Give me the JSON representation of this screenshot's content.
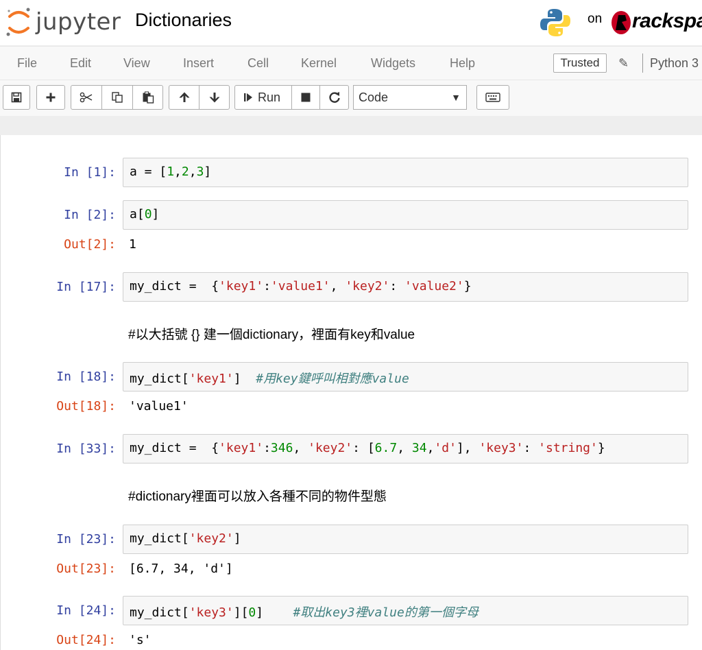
{
  "header": {
    "logo_text": "jupyter",
    "notebook_title": "Dictionaries",
    "on_text": "on",
    "rackspace_text": "rackspace"
  },
  "menubar": {
    "items": [
      "File",
      "Edit",
      "View",
      "Insert",
      "Cell",
      "Kernel",
      "Widgets",
      "Help"
    ],
    "trusted_label": "Trusted",
    "kernel_name": "Python 3"
  },
  "toolbar": {
    "run_label": "Run",
    "cell_type": "Code",
    "buttons": [
      "save-icon",
      "plus-icon",
      "scissors-icon",
      "copy-icon",
      "paste-icon",
      "arrow-up-icon",
      "arrow-down-icon",
      "run-icon",
      "stop-icon",
      "restart-icon",
      "keyboard-icon"
    ]
  },
  "colors": {
    "in_prompt": "#303f9f",
    "out_prompt": "#d84315",
    "number": "#008800",
    "string": "#ba2121",
    "comment": "#408080",
    "logo_orange": "#f37726"
  },
  "cells": [
    {
      "in_prompt": "In [1]:",
      "code": [
        [
          "a = [",
          ""
        ],
        [
          "1",
          "num"
        ],
        [
          ",",
          ""
        ],
        [
          "2",
          "num"
        ],
        [
          ",",
          ""
        ],
        [
          "3",
          "num"
        ],
        [
          "]",
          ""
        ]
      ]
    },
    {
      "in_prompt": "In [2]:",
      "code": [
        [
          "a[",
          ""
        ],
        [
          "0",
          "num"
        ],
        [
          "]",
          ""
        ]
      ],
      "out_prompt": "Out[2]:",
      "output": "1"
    },
    {
      "in_prompt": "In [17]:",
      "code": [
        [
          "my_dict =  {",
          ""
        ],
        [
          "'key1'",
          "str"
        ],
        [
          ":",
          ""
        ],
        [
          "'value1'",
          "str"
        ],
        [
          ", ",
          ""
        ],
        [
          "'key2'",
          "str"
        ],
        [
          ": ",
          ""
        ],
        [
          "'value2'",
          "str"
        ],
        [
          "}",
          ""
        ]
      ]
    },
    {
      "markdown": "#以大括號 {} 建一個dictionary，裡面有key和value"
    },
    {
      "in_prompt": "In [18]:",
      "code": [
        [
          "my_dict[",
          ""
        ],
        [
          "'key1'",
          "str"
        ],
        [
          "]  ",
          ""
        ],
        [
          "#用key鍵呼叫相對應value",
          "cm"
        ]
      ],
      "out_prompt": "Out[18]:",
      "output": "'value1'"
    },
    {
      "in_prompt": "In [33]:",
      "code": [
        [
          "my_dict =  {",
          ""
        ],
        [
          "'key1'",
          "str"
        ],
        [
          ":",
          ""
        ],
        [
          "346",
          "num"
        ],
        [
          ", ",
          ""
        ],
        [
          "'key2'",
          "str"
        ],
        [
          ": [",
          ""
        ],
        [
          "6.7",
          "num"
        ],
        [
          ", ",
          ""
        ],
        [
          "34",
          "num"
        ],
        [
          ",",
          ""
        ],
        [
          "'d'",
          "str"
        ],
        [
          "], ",
          ""
        ],
        [
          "'key3'",
          "str"
        ],
        [
          ": ",
          ""
        ],
        [
          "'string'",
          "str"
        ],
        [
          "}",
          ""
        ]
      ]
    },
    {
      "markdown": "#dictionary裡面可以放入各種不同的物件型態"
    },
    {
      "in_prompt": "In [23]:",
      "code": [
        [
          "my_dict[",
          ""
        ],
        [
          "'key2'",
          "str"
        ],
        [
          "]",
          ""
        ]
      ],
      "out_prompt": "Out[23]:",
      "output": "[6.7, 34, 'd']"
    },
    {
      "in_prompt": "In [24]:",
      "code": [
        [
          "my_dict[",
          ""
        ],
        [
          "'key3'",
          "str"
        ],
        [
          "][",
          ""
        ],
        [
          "0",
          "num"
        ],
        [
          "]    ",
          ""
        ],
        [
          "#取出key3裡value的第一個字母",
          "cm"
        ]
      ],
      "out_prompt": "Out[24]:",
      "output": "'s'"
    }
  ]
}
